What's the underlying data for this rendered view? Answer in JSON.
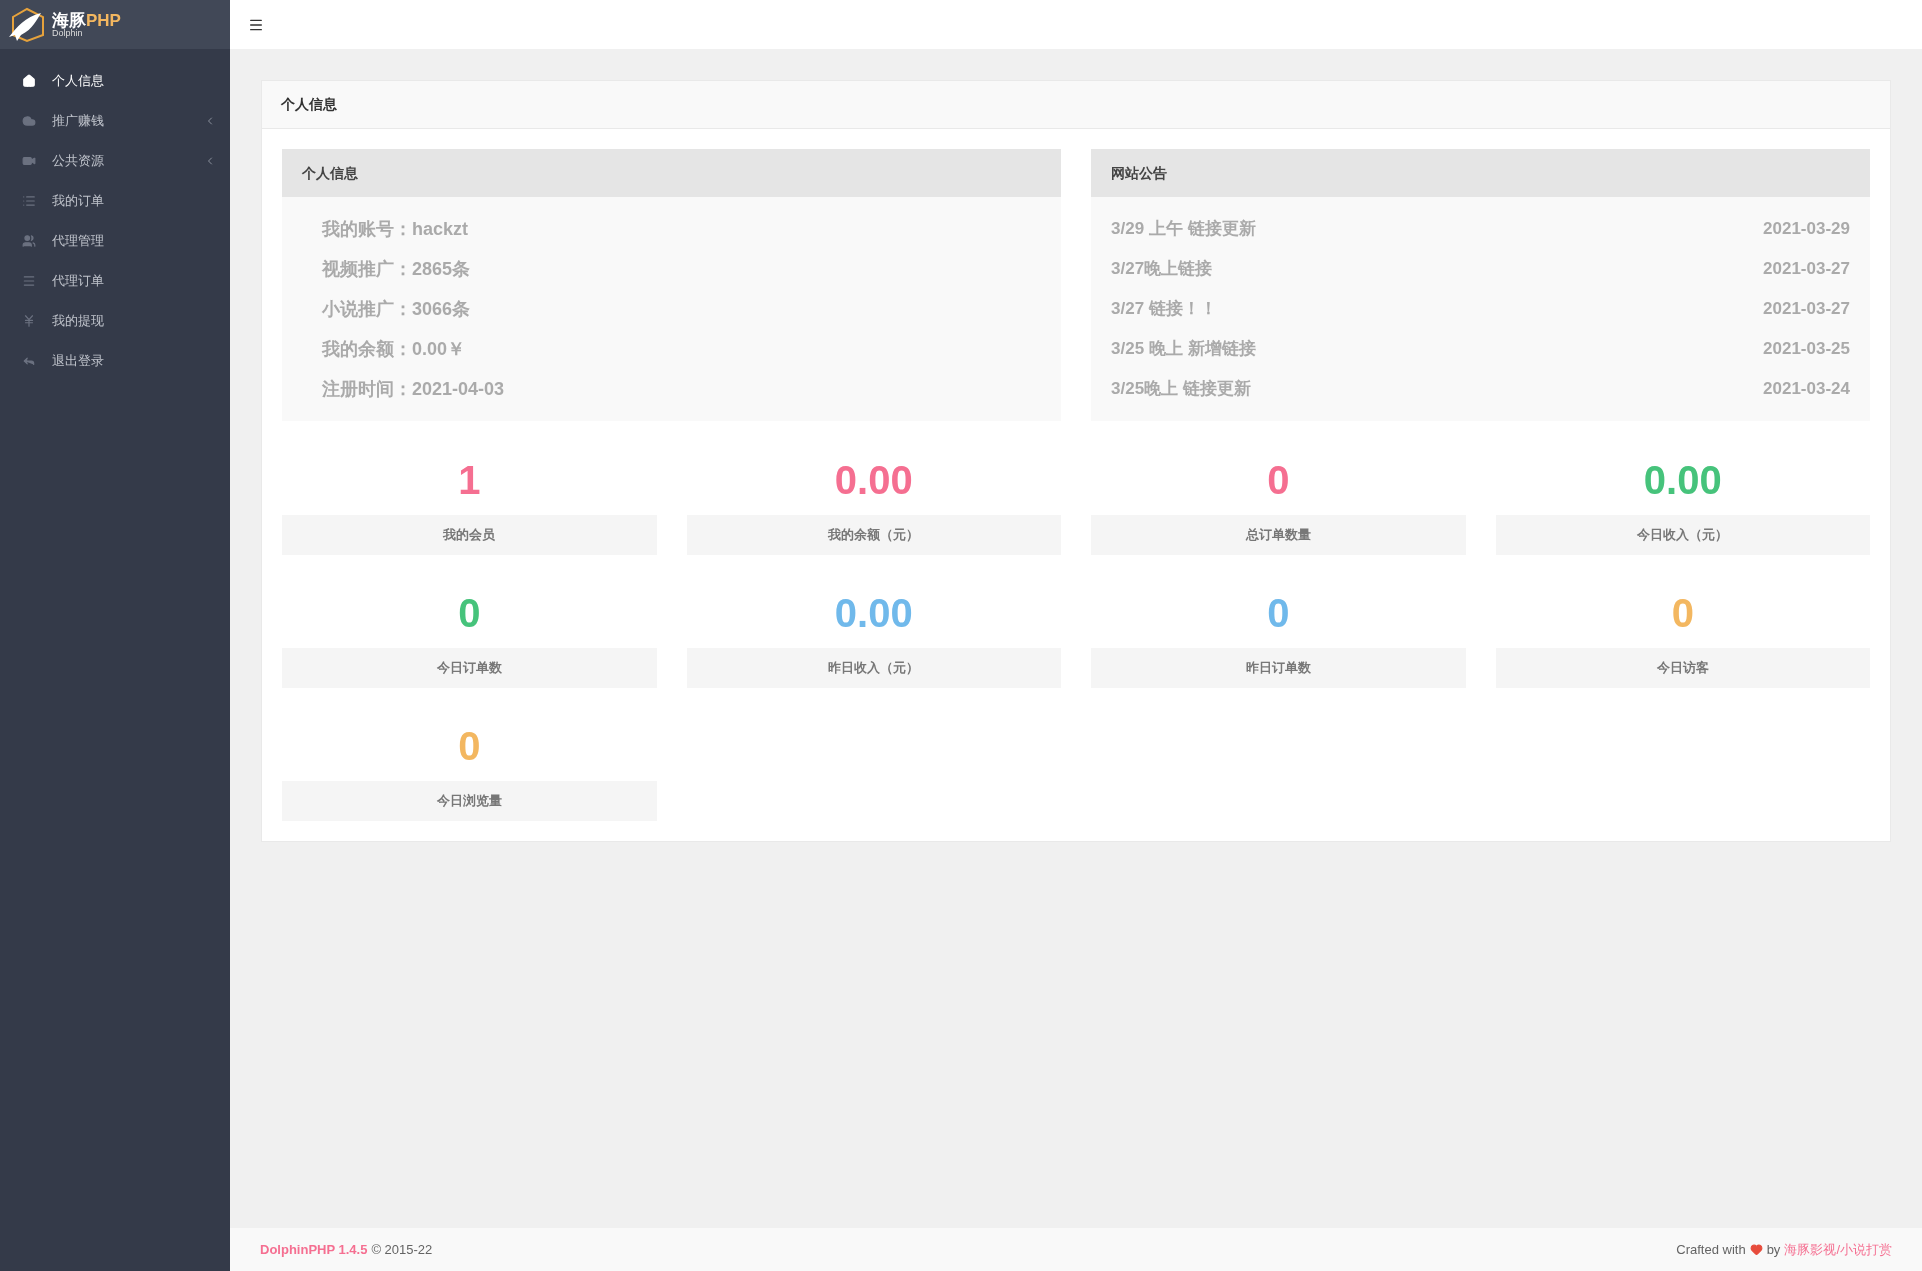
{
  "logo": {
    "title_cn": "海豚",
    "title_en": "PHP",
    "subtitle": "Dolphin"
  },
  "sidebar": {
    "items": [
      {
        "label": "个人信息",
        "selected": true,
        "submenu": false
      },
      {
        "label": "推广赚钱",
        "selected": false,
        "submenu": true
      },
      {
        "label": "公共资源",
        "selected": false,
        "submenu": true
      },
      {
        "label": "我的订单",
        "selected": false,
        "submenu": false
      },
      {
        "label": "代理管理",
        "selected": false,
        "submenu": false
      },
      {
        "label": "代理订单",
        "selected": false,
        "submenu": false
      },
      {
        "label": "我的提现",
        "selected": false,
        "submenu": false
      },
      {
        "label": "退出登录",
        "selected": false,
        "submenu": false
      }
    ]
  },
  "panel": {
    "title": "个人信息",
    "profile": {
      "title": "个人信息",
      "rows": [
        "我的账号：hackzt",
        "视频推广：2865条",
        "小说推广：3066条",
        "我的余额：0.00￥",
        "注册时间：2021-04-03"
      ]
    },
    "notices": {
      "title": "网站公告",
      "rows": [
        {
          "text": "3/29 上午 链接更新",
          "date": "2021-03-29"
        },
        {
          "text": "3/27晚上链接",
          "date": "2021-03-27"
        },
        {
          "text": "3/27 链接！！",
          "date": "2021-03-27"
        },
        {
          "text": "3/25 晚上 新增链接",
          "date": "2021-03-25"
        },
        {
          "text": "3/25晚上 链接更新",
          "date": "2021-03-24"
        }
      ]
    },
    "stats": [
      {
        "value": "1",
        "label": "我的会员",
        "color": "#f56f91"
      },
      {
        "value": "0.00",
        "label": "我的余额（元）",
        "color": "#f56f91"
      },
      {
        "value": "0",
        "label": "总订单数量",
        "color": "#f56f91"
      },
      {
        "value": "0.00",
        "label": "今日收入（元）",
        "color": "#46c37b"
      },
      {
        "value": "0",
        "label": "今日订单数",
        "color": "#46c37b"
      },
      {
        "value": "0.00",
        "label": "昨日收入（元）",
        "color": "#70b9eb"
      },
      {
        "value": "0",
        "label": "昨日订单数",
        "color": "#70b9eb"
      },
      {
        "value": "0",
        "label": "今日访客",
        "color": "#f3b760"
      },
      {
        "value": "0",
        "label": "今日浏览量",
        "color": "#f3b760"
      }
    ]
  },
  "footer": {
    "product": "DolphinPHP 1.4.5",
    "copyright": "© 2015-22",
    "crafted": "Crafted with",
    "by": "by",
    "author": "海豚影视/小说打赏"
  }
}
